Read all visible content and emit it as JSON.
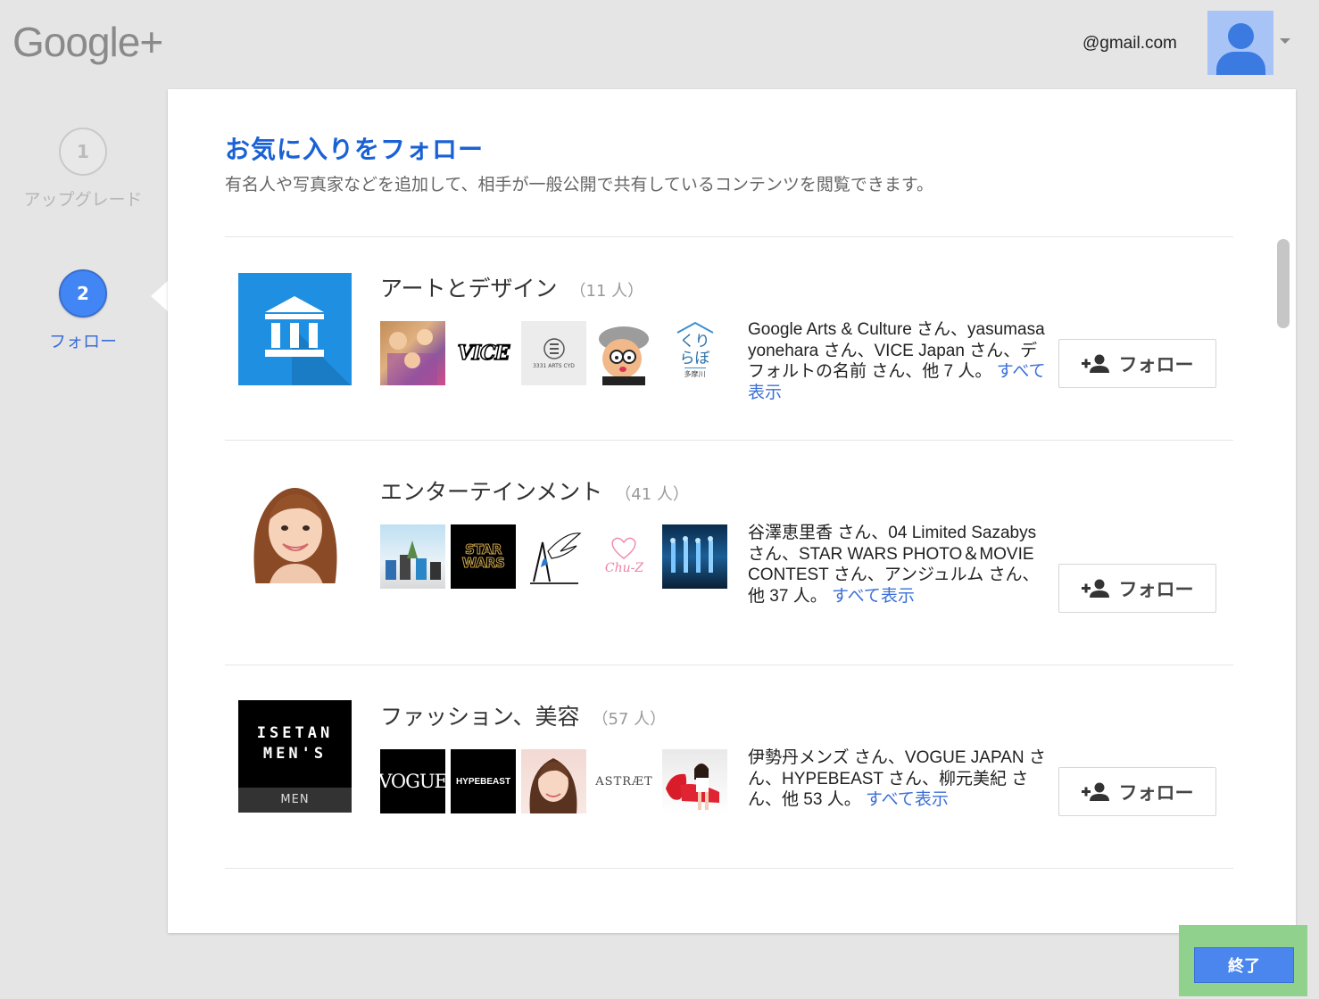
{
  "header": {
    "logo": "Google+",
    "email": "@gmail.com"
  },
  "steps": [
    {
      "number": "1",
      "label": "アップグレード"
    },
    {
      "number": "2",
      "label": "フォロー"
    }
  ],
  "card": {
    "title": "お気に入りをフォロー",
    "subtitle": "有名人や写真家などを追加して、相手が一般公開で共有しているコンテンツを閲覧できます。"
  },
  "categories": [
    {
      "name": "アートとデザイン",
      "count": "（11 人）",
      "desc": "Google Arts & Culture さん、yasumasa yonehara さん、VICE Japan さん、デフォルトの名前 さん、他 7 人。",
      "more": "すべて表示",
      "follow": "フォロー",
      "thumb_texts": [
        "VICE",
        "3331 ARTS CYD",
        "くりらぼ",
        "多摩川"
      ]
    },
    {
      "name": "エンターテインメント",
      "count": "（41 人）",
      "desc": "谷澤恵里香 さん、04 Limited Sazabys さん、STAR WARS PHOTO＆MOVIE CONTEST さん、アンジュルム さん、他 37 人。",
      "more": "すべて表示",
      "follow": "フォロー",
      "thumb_texts": [
        "STAR WARS",
        "Chu-Z"
      ]
    },
    {
      "name": "ファッション、美容",
      "count": "（57 人）",
      "desc": "伊勢丹メンズ さん、VOGUE JAPAN さん、HYPEBEAST さん、柳元美紀 さん、他 53 人。",
      "more": "すべて表示",
      "follow": "フォロー",
      "thumb_texts": [
        "VOGUE",
        "HYPEBEAST",
        "ASTRÆT"
      ],
      "logo_text": [
        "ISETAN",
        "MEN'S",
        "MEN"
      ]
    }
  ],
  "footer": {
    "finish_label": "終了"
  },
  "colors": {
    "accent": "#4285f4",
    "title": "#1a61d5",
    "link": "#3a6fd8",
    "finish_highlight": "#8fd18d"
  }
}
